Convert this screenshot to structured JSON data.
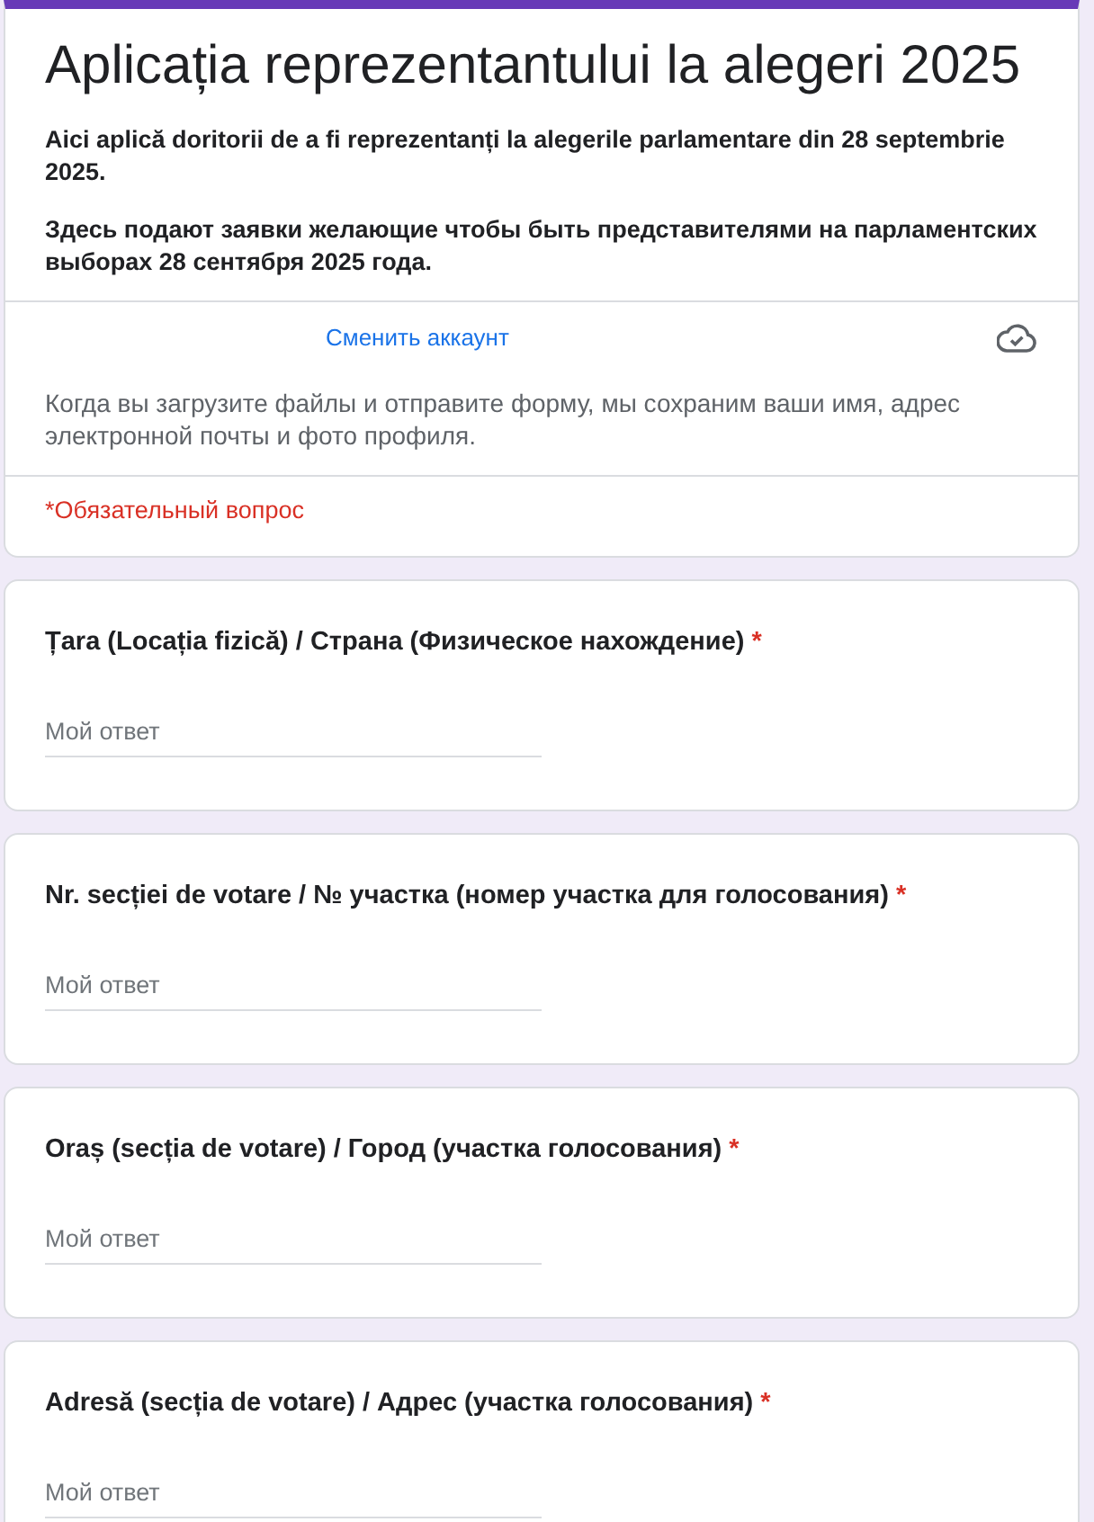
{
  "header": {
    "title": "Aplicația reprezentantului la alegeri 2025",
    "description": [
      "Aici aplică doritorii de a fi reprezentanți la alegerile parlamentare din 28 septembrie 2025.",
      "Здесь подают заявки желающие чтобы быть представителями на парламентских выборах 28 сентября 2025 года."
    ],
    "account": {
      "switch_link": "Сменить аккаунт",
      "notice": "Когда вы загрузите файлы и отправите форму, мы сохраним ваши имя, адрес электронной почты и фото профиля."
    },
    "required_note": "*Обязательный вопрос"
  },
  "questions": [
    {
      "title": "Țara (Locația fizică) / Страна (Физическое нахождение)",
      "required_mark": "*",
      "answer": {
        "placeholder": "Мой ответ"
      }
    },
    {
      "title": "Nr. secției de votare / № участка (номер участка для голосования)",
      "required_mark": "*",
      "answer": {
        "placeholder": "Мой ответ"
      }
    },
    {
      "title": "Oraș (secția de votare) / Город (участка голосования)",
      "required_mark": "*",
      "answer": {
        "placeholder": "Мой ответ"
      }
    },
    {
      "title": "Adresă (secția de votare) / Адрес (участка голосования)",
      "required_mark": "*",
      "answer": {
        "placeholder": "Мой ответ"
      }
    }
  ]
}
